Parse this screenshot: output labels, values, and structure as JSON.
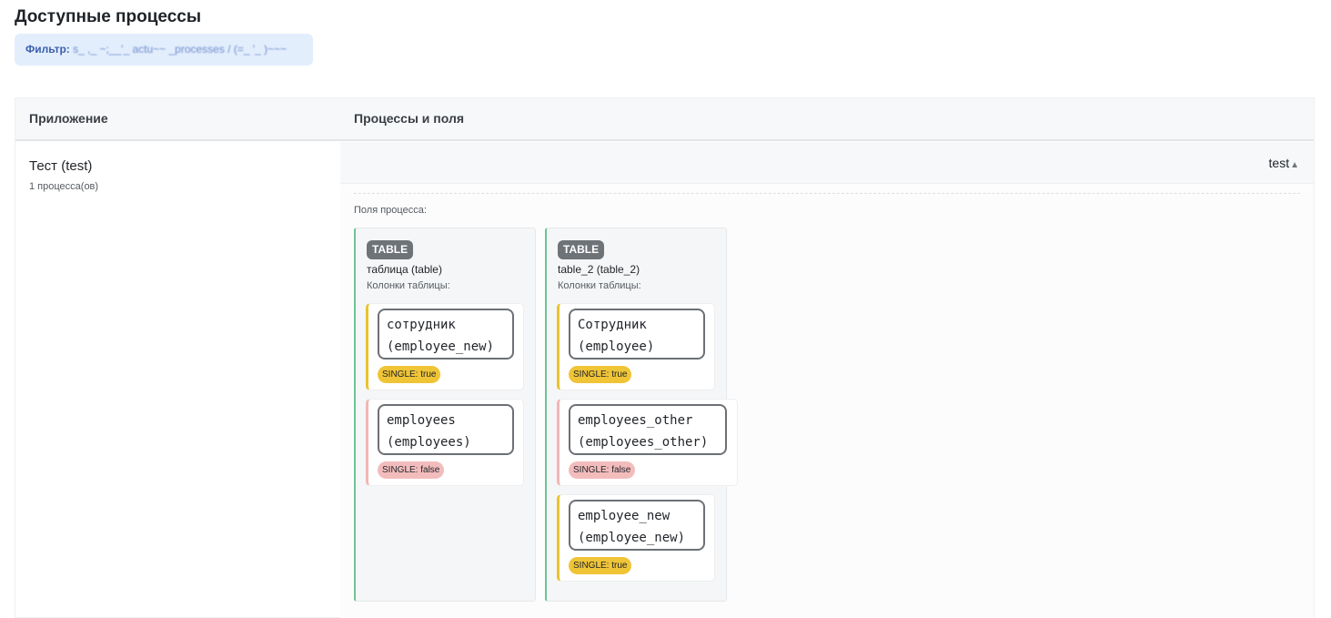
{
  "page_title": "Доступные процессы",
  "filter": {
    "label": "Фильтр:",
    "value": "s_ ,_ ~;__'_ actu~~ _processes / (=_   '_ )~~~"
  },
  "table": {
    "headers": {
      "app": "Приложение",
      "processes": "Процессы и поля"
    },
    "row": {
      "app_name": "Тест (test)",
      "process_count": "1 процесса(ов)",
      "process_toggle": {
        "label": "test",
        "icon": "caret-up-icon",
        "expanded": true
      },
      "fields_label": "Поля процесса:",
      "table_fields": [
        {
          "badge": "TABLE",
          "name": "таблица (table)",
          "columns_label": "Колонки таблицы:",
          "columns": [
            {
              "line1": "сотрудник",
              "line2": "(employee_new)",
              "single": "SINGLE: true",
              "single_value": true
            },
            {
              "line1": "employees",
              "line2": "(employees)",
              "single": "SINGLE: false",
              "single_value": false
            }
          ]
        },
        {
          "badge": "TABLE",
          "name": "table_2 (table_2)",
          "columns_label": "Колонки таблицы:",
          "columns": [
            {
              "line1": "Сотрудник",
              "line2": "(employee)",
              "single": "SINGLE: true",
              "single_value": true
            },
            {
              "line1": "employees_other",
              "line2": "(employees_other)",
              "single": "SINGLE: false",
              "single_value": false
            },
            {
              "line1": "employee_new",
              "line2": "(employee_new)",
              "single": "SINGLE: true",
              "single_value": true
            }
          ]
        }
      ]
    }
  },
  "colors": {
    "single_true": "#efc437",
    "single_false": "#f3bcbc",
    "table_accent": "#6cc493",
    "badge_bg": "#6e7378",
    "filter_bg": "#e3eefc"
  }
}
